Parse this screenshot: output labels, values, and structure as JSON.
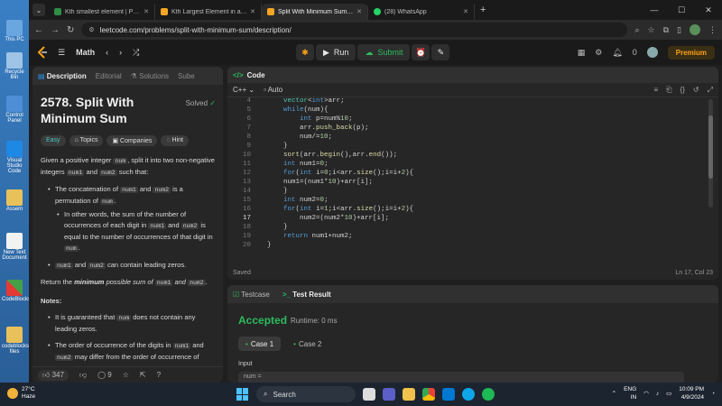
{
  "desktop": {
    "icons": [
      "This PC",
      "Recycle Bin",
      "Control Panel",
      "Visual Studio Code",
      "Assem",
      "New Text Document",
      "CodeBlocks",
      "codeblocks files"
    ]
  },
  "browser": {
    "tabs": [
      {
        "title": "Kth smallest element | Practice |"
      },
      {
        "title": "Kth Largest Element in an Array"
      },
      {
        "title": "Split With Minimum Sum - Lee"
      },
      {
        "title": "(28) WhatsApp"
      }
    ],
    "url": "leetcode.com/problems/split-with-minimum-sum/description/"
  },
  "lc_header": {
    "math_label": "Math",
    "run_label": "Run",
    "submit_label": "Submit",
    "notif_count": "0",
    "premium_label": "Premium"
  },
  "problem": {
    "tabs": [
      "Description",
      "Editorial",
      "Solutions",
      "Sube"
    ],
    "title": "2578. Split With Minimum Sum",
    "solved": "Solved",
    "tags": [
      "Easy",
      "Topics",
      "Companies",
      "Hint"
    ],
    "p1a": "Given a positive integer",
    "p1_num": "num",
    "p1b": ", split it into two non-negative integers",
    "p1_num1": "num1",
    "p1c": "and",
    "p1_num2": "num2",
    "p1d": "such that:",
    "b1a": "The concatenation of",
    "b1_num1": "num1",
    "b1b": "and",
    "b1_num2": "num2",
    "b1c": "is a permutation of",
    "b1_num": "num",
    "b1d": ".",
    "b2a": "In other words, the sum of the number of occurrences of each digit in",
    "b2_num1": "num1",
    "b2b": "and",
    "b2_num2": "num2",
    "b2c": "is equal to the number of occurrences of that digit in",
    "b2_num": "num",
    "b2d": ".",
    "b3_num1": "num1",
    "b3a": "and",
    "b3_num2": "num2",
    "b3b": "can contain leading zeros.",
    "ret_a": "Return the",
    "ret_b": "minimum",
    "ret_c": "possible sum of",
    "ret_num1": "num1",
    "ret_d": "and",
    "ret_num2": "num2",
    "ret_e": ".",
    "notes": "Notes:",
    "n1a": "It is guaranteed that",
    "n1_num": "num",
    "n1b": "does not contain any leading zeros.",
    "n2a": "The order of occurrence of the digits in",
    "n2_num1": "num1",
    "n2b": "and",
    "n2_num2": "num2",
    "n2c": "may differ from the order of occurrence of",
    "likes": "347",
    "comments": "9"
  },
  "code": {
    "title": "Code",
    "language": "C++",
    "mode": "Auto",
    "line_numbers": [
      "4",
      "5",
      "6",
      "7",
      "8",
      "9",
      "10",
      "11",
      "12",
      "13",
      "14",
      "15",
      "16",
      "17",
      "18",
      "19",
      "20"
    ],
    "status": "Saved",
    "cursor": "Ln 17, Col 23"
  },
  "result": {
    "tab_testcase": "Testcase",
    "tab_result": "Test Result",
    "verdict": "Accepted",
    "runtime": "Runtime: 0 ms",
    "cases": [
      "Case 1",
      "Case 2"
    ],
    "input_label": "Input",
    "input_value": "num ="
  },
  "taskbar": {
    "temp": "27°C",
    "weather": "Haze",
    "search": "Search",
    "lang": "ENG",
    "region": "IN",
    "time": "10:09 PM",
    "date": "4/9/2024"
  }
}
